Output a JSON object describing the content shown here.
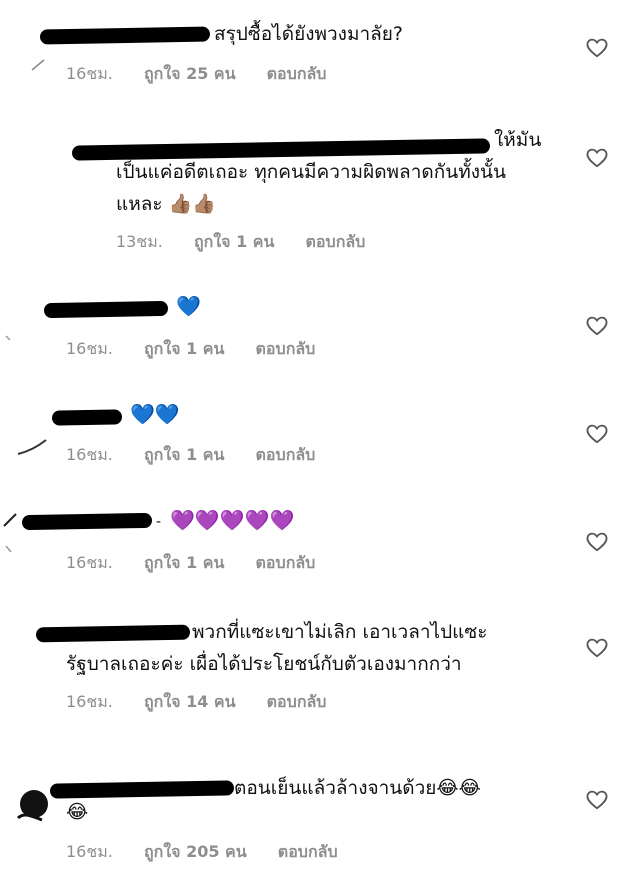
{
  "colors": {
    "meta_gray": "#8e8e8e",
    "text": "#111111",
    "redaction": "#000000",
    "blue_heart": "#1e6cf2",
    "purple_heart": "#8a2be2"
  },
  "comments": [
    {
      "text": "สรุปซื้อได้ยังพวงมาลัย?",
      "time": "16ชม.",
      "likes": "ถูกใจ 25 คน",
      "reply": "ตอบกลับ"
    },
    {
      "text_lines": [
        "ให้มัน",
        "เป็นแค่อดีตเถอะ ทุกคนมีความผิดพลาดกันทั้งนั้น",
        "แหละ 👍🏽👍🏽"
      ],
      "time": "13ชม.",
      "likes": "ถูกใจ 1 คน",
      "reply": "ตอบกลับ"
    },
    {
      "text": "💙",
      "time": "16ชม.",
      "likes": "ถูกใจ 1 คน",
      "reply": "ตอบกลับ"
    },
    {
      "text": "💙💙",
      "time": "16ชม.",
      "likes": "ถูกใจ 1 คน",
      "reply": "ตอบกลับ"
    },
    {
      "text": "💜💜💜💜💜",
      "time": "16ชม.",
      "likes": "ถูกใจ 1 คน",
      "reply": "ตอบกลับ"
    },
    {
      "text_lines": [
        "พวกที่แซะเขาไม่เลิก เอาเวลาไปแซะ",
        "รัฐบาลเถอะค่ะ เผื่อได้ประโยชน์กับตัวเองมากกว่า"
      ],
      "time": "16ชม.",
      "likes": "ถูกใจ 14 คน",
      "reply": "ตอบกลับ"
    },
    {
      "text_lines": [
        "ตอนเย็นแล้วล้างจานด้วย😂😂",
        "😂"
      ],
      "time": "16ชม.",
      "likes": "ถูกใจ 205 คน",
      "reply": "ตอบกลับ"
    }
  ],
  "icons": {
    "like": "heart-outline-icon"
  }
}
